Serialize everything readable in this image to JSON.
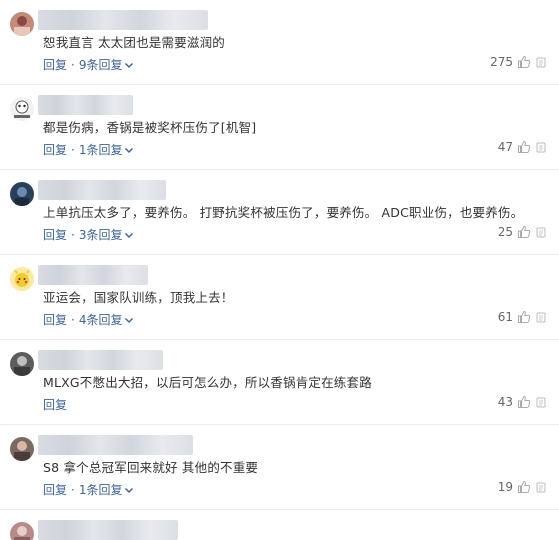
{
  "comments": [
    {
      "text": "恕我直言 太太团也是需要滋润的",
      "reply_label": "回复",
      "sep": "·",
      "replies_label": "9条回复",
      "likes": "275"
    },
    {
      "text": "都是伤病，香锅是被奖杯压伤了[机智]",
      "reply_label": "回复",
      "sep": "·",
      "replies_label": "1条回复",
      "likes": "47"
    },
    {
      "text": "上单抗压太多了，要养伤。 打野抗奖杯被压伤了，要养伤。 ADC职业伤，也要养伤。",
      "reply_label": "回复",
      "sep": "·",
      "replies_label": "3条回复",
      "likes": "25"
    },
    {
      "text": "亚运会，国家队训练，顶我上去！",
      "reply_label": "回复",
      "sep": "·",
      "replies_label": "4条回复",
      "likes": "61"
    },
    {
      "text": "MLXG不憋出大招，以后可怎么办，所以香锅肯定在练套路",
      "reply_label": "回复",
      "sep": "",
      "replies_label": "",
      "likes": "43"
    },
    {
      "text": "S8 拿个总冠军回来就好 其他的不重要",
      "reply_label": "回复",
      "sep": "·",
      "replies_label": "1条回复",
      "likes": "19"
    }
  ],
  "icons": {
    "chevron": "chevron-down-icon",
    "thumb": "thumbs-up-icon",
    "more": "more-icon"
  },
  "colors": {
    "link": "#406599",
    "text": "#333333",
    "count": "#666666"
  }
}
